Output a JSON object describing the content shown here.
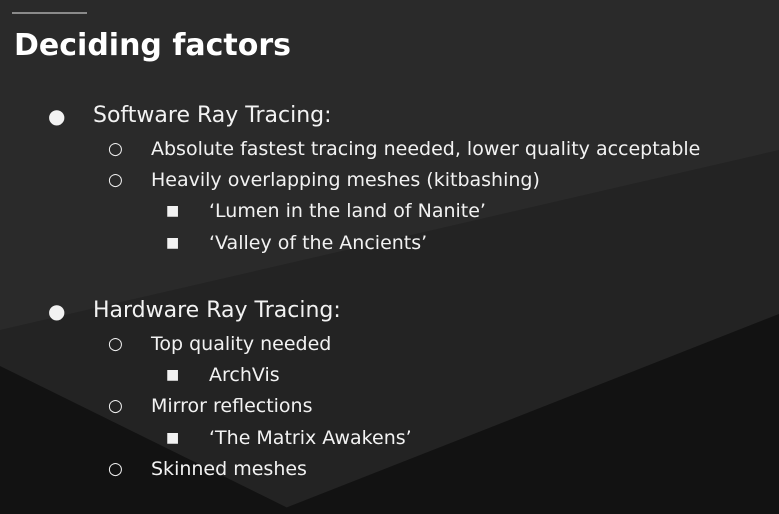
{
  "slide": {
    "title": "Deciding factors",
    "colors": {
      "background": "#232323",
      "shade": "#121212",
      "text": "#f2f2f2",
      "title_rule": "#8a8a8a"
    }
  },
  "bullets": {
    "disc": "●",
    "circle": "○",
    "square": "■"
  },
  "sections": [
    {
      "heading": "Software Ray Tracing:",
      "items": [
        {
          "text": "Absolute fastest tracing needed, lower quality acceptable"
        },
        {
          "text": "Heavily overlapping meshes (kitbashing)",
          "sub": [
            "‘Lumen in the land of Nanite’",
            "‘Valley of the Ancients’"
          ]
        }
      ]
    },
    {
      "heading": "Hardware Ray Tracing:",
      "items": [
        {
          "text": "Top quality needed",
          "sub": [
            "ArchVis"
          ]
        },
        {
          "text": "Mirror reflections",
          "sub": [
            "‘The Matrix Awakens’"
          ]
        },
        {
          "text": "Skinned meshes"
        }
      ]
    }
  ]
}
